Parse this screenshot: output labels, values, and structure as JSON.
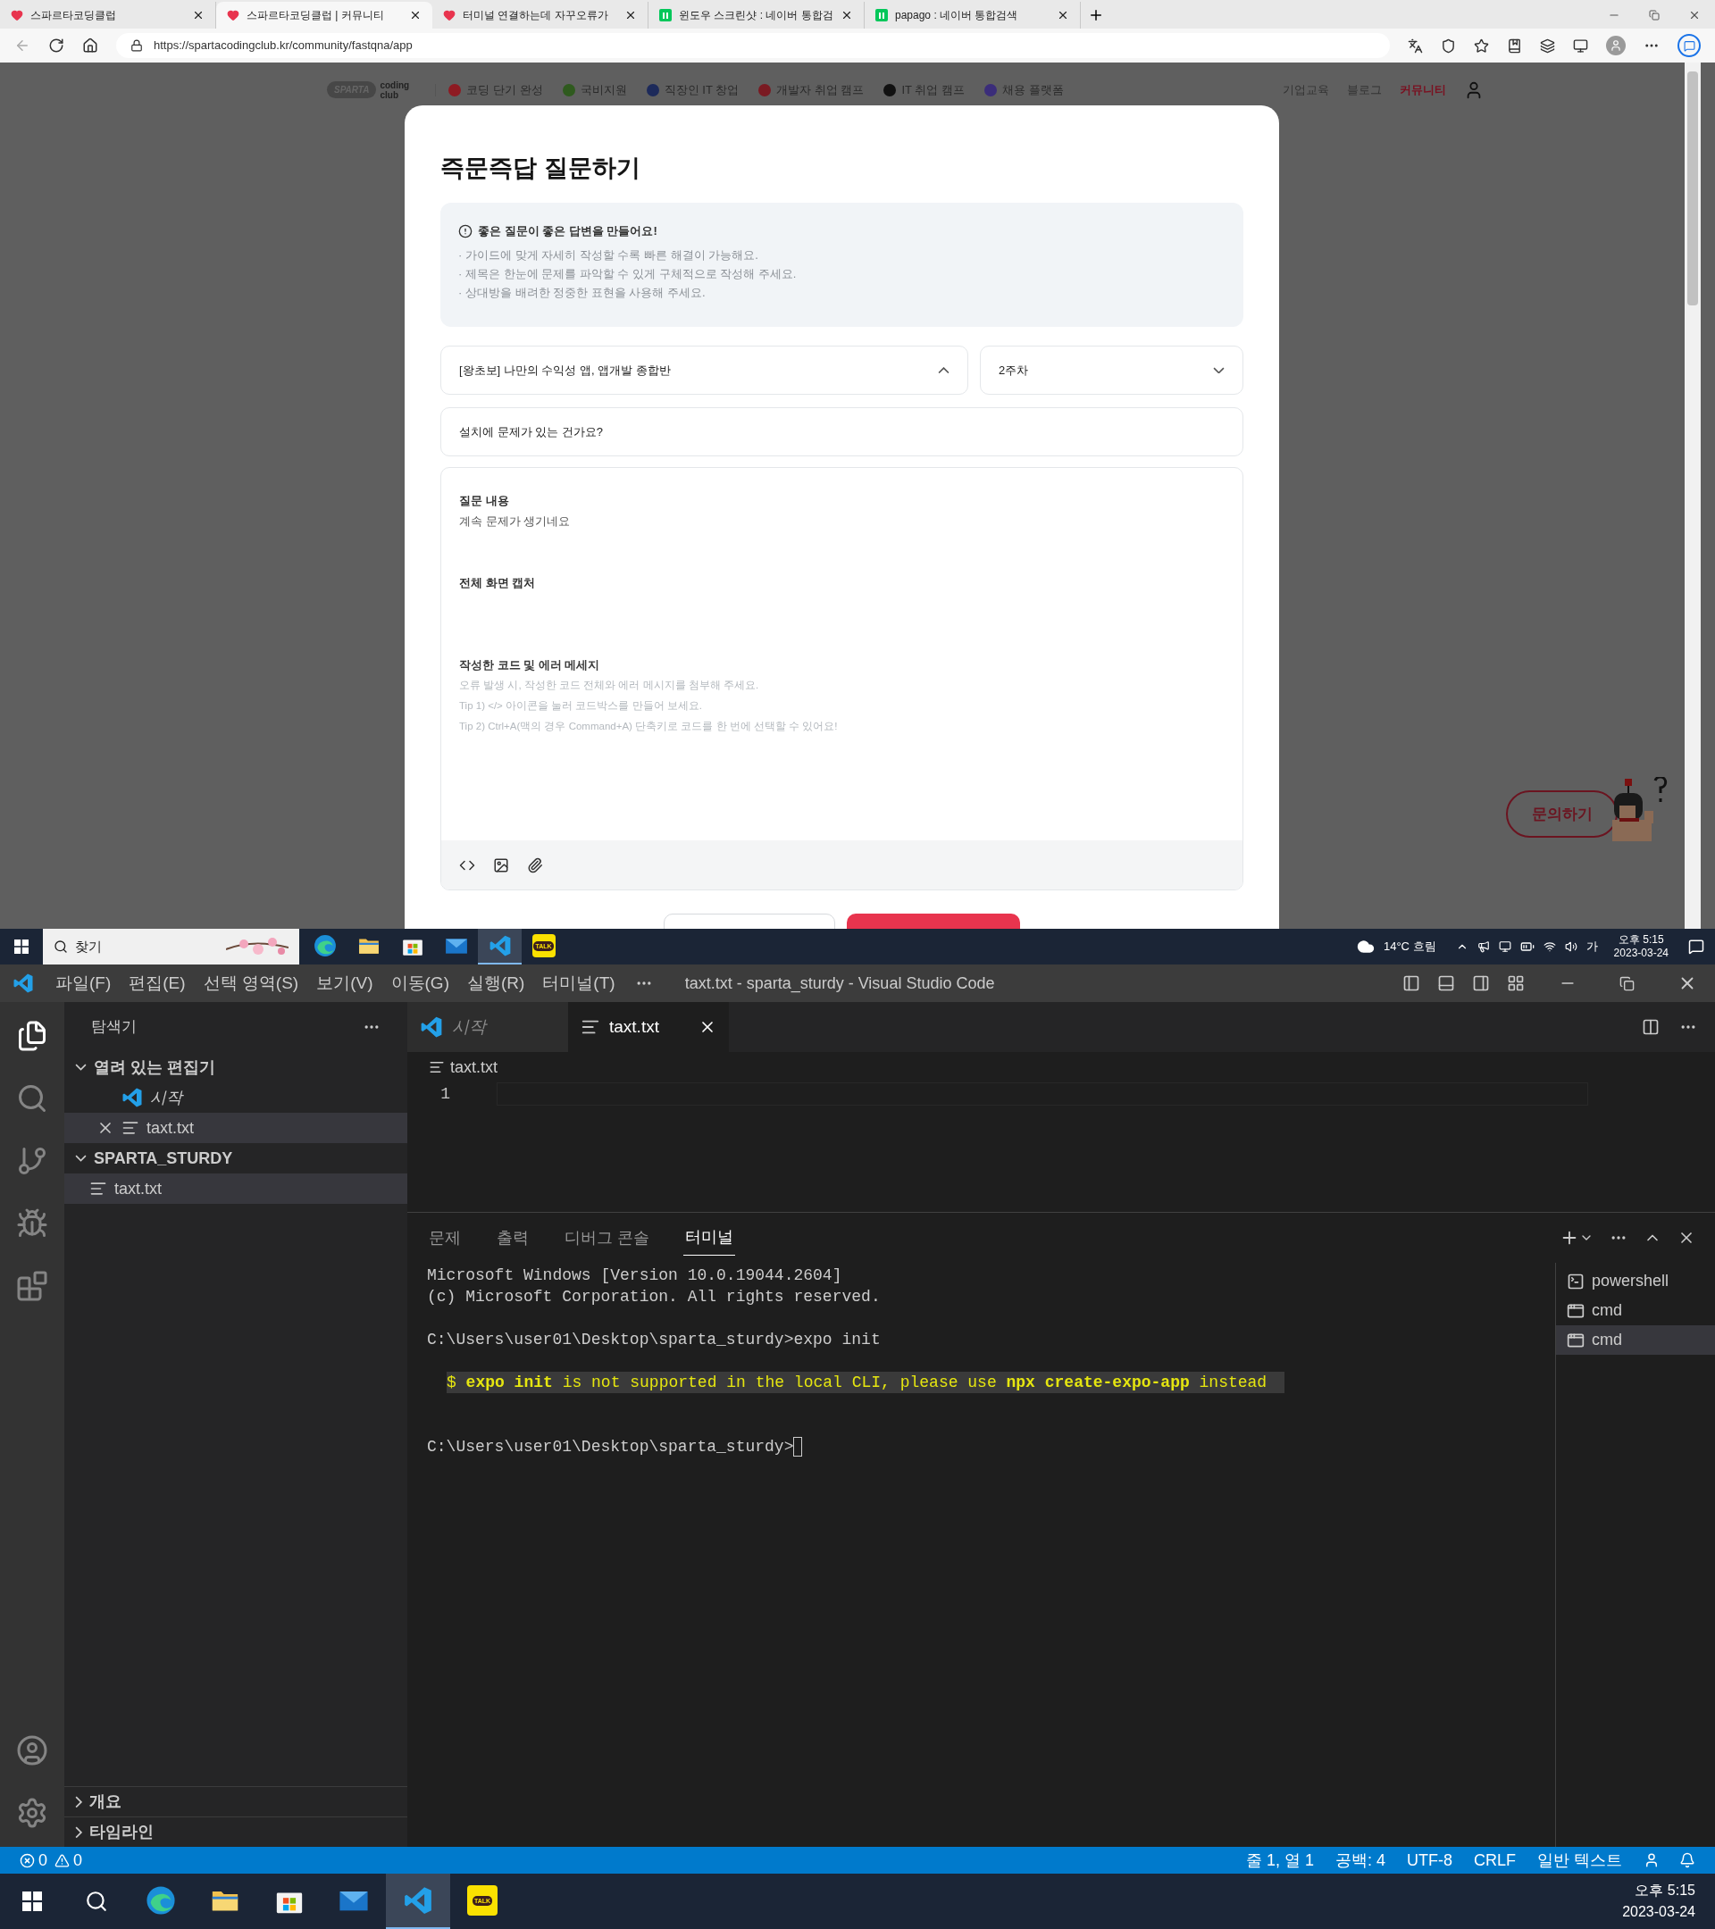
{
  "browser": {
    "tabs": [
      {
        "title": "스파르타코딩클럽",
        "selected": false,
        "kind": "sparta"
      },
      {
        "title": "스파르타코딩클럽 | 커뮤니티",
        "selected": true,
        "kind": "sparta"
      },
      {
        "title": "터미널 연결하는데 자꾸오류가",
        "selected": false,
        "kind": "sparta"
      },
      {
        "title": "윈도우 스크린샷 : 네이버 통합검",
        "selected": false,
        "kind": "naver"
      },
      {
        "title": "papago : 네이버 통합검색",
        "selected": false,
        "kind": "naver"
      }
    ],
    "url": "https://spartacodingclub.kr/community/fastqna/app"
  },
  "site": {
    "logo_words": [
      "SPARTA",
      "coding club"
    ],
    "nav": [
      {
        "label": "코딩 단기 완성",
        "color": "#8e1a22"
      },
      {
        "label": "국비지원",
        "color": "#2f5a1e"
      },
      {
        "label": "직장인 IT 창업",
        "color": "#1d2a5a"
      },
      {
        "label": "개발자 취업 캠프",
        "color": "#7a1a22"
      },
      {
        "label": "IT 취업 캠프",
        "color": "#111111"
      },
      {
        "label": "채용 플랫폼",
        "color": "#3b2d7a"
      }
    ],
    "links": [
      {
        "label": "기업교육",
        "selected": false
      },
      {
        "label": "블로그",
        "selected": false
      },
      {
        "label": "커뮤니티",
        "selected": true
      }
    ],
    "help_button": "문의하기"
  },
  "modal": {
    "title": "즉문즉답 질문하기",
    "notice": {
      "heading": "좋은 질문이 좋은 답변을 만들어요!",
      "lines": [
        "· 가이드에 맞게 자세히 작성할 수록 빠른 해결이 가능해요.",
        "· 제목은 한눈에 문제를 파악할 수 있게 구체적으로 작성해 주세요.",
        "· 상대방을 배려한 정중한 표현을 사용해 주세요."
      ]
    },
    "course_select": {
      "value": "[왕초보] 나만의 수익성 앱, 앱개발 종합반",
      "expanded": true
    },
    "week_select": {
      "value": "2주차",
      "expanded": false
    },
    "title_field": {
      "value": "설치에 문제가 있는 건가요?"
    },
    "sections": [
      {
        "heading": "질문 내용",
        "kind": "text",
        "lines": [
          "계속 문제가 생기네요"
        ]
      },
      {
        "heading": "전체 화면 캡처",
        "kind": "text"
      },
      {
        "heading": "작성한 코드 및 에러 메세지",
        "kind": "hint",
        "lines": [
          "오류 발생 시, 작성한 코드 전체와 에러 메시지를 첨부해 주세요.",
          "Tip 1) </> 아이콘을 눌러 코드박스를 만들어 보세요.",
          "Tip 2) Ctrl+A(맥의 경우 Command+A) 단축키로 코드를 한 번에 선택할 수 있어요!"
        ]
      }
    ]
  },
  "taskbar_top": {
    "search_placeholder": "찾기",
    "weather": "14°C 흐림",
    "ime": "가",
    "time": "오후 5:15",
    "date": "2023-03-24",
    "apps": [
      {
        "kind": "edge",
        "active": false
      },
      {
        "kind": "files",
        "active": false
      },
      {
        "kind": "store",
        "active": false
      },
      {
        "kind": "mail",
        "active": false
      },
      {
        "kind": "vscode",
        "active": true
      },
      {
        "kind": "kakao",
        "label": "TALK",
        "active": false
      }
    ]
  },
  "vscode": {
    "menu": [
      "파일(F)",
      "편집(E)",
      "선택 영역(S)",
      "보기(V)",
      "이동(G)",
      "실행(R)",
      "터미널(T)"
    ],
    "title": "taxt.txt - sparta_sturdy - Visual Studio Code",
    "explorer": {
      "title": "탐색기",
      "sections": [
        {
          "label": "열려 있는 편집기",
          "expanded": true,
          "kind": "open_editors",
          "items": [
            {
              "name": "시작",
              "kind": "welcome",
              "selected": false
            },
            {
              "name": "taxt.txt",
              "kind": "file",
              "selected": true
            }
          ]
        },
        {
          "label": "SPARTA_STURDY",
          "expanded": true,
          "kind": "folder",
          "items": [
            {
              "name": "taxt.txt",
              "kind": "file",
              "selected": true
            }
          ]
        }
      ],
      "bottom_sections": [
        {
          "label": "개요",
          "expanded": false
        },
        {
          "label": "타임라인",
          "expanded": false
        }
      ]
    },
    "editor_tabs": [
      {
        "label": "시작",
        "kind": "welcome",
        "selected": false
      },
      {
        "label": "taxt.txt",
        "kind": "file",
        "selected": true
      }
    ],
    "breadcrumb": "taxt.txt",
    "line_numbers": [
      "1"
    ],
    "panel_tabs": [
      {
        "label": "문제",
        "selected": false
      },
      {
        "label": "출력",
        "selected": false
      },
      {
        "label": "디버그 콘솔",
        "selected": false
      },
      {
        "label": "터미널",
        "selected": true
      }
    ],
    "terminal_lines": [
      {
        "kind": "text",
        "text": "Microsoft Windows [Version 10.0.19044.2604]"
      },
      {
        "kind": "text",
        "text": "(c) Microsoft Corporation. All rights reserved."
      },
      {
        "kind": "blank"
      },
      {
        "kind": "text",
        "text": "C:\\Users\\user01\\Desktop\\sparta_sturdy>expo init"
      },
      {
        "kind": "blank"
      },
      {
        "kind": "warning",
        "text": "$ **expo init** is not supported in the local CLI, please use **npx create-expo-app** instead"
      },
      {
        "kind": "blank"
      },
      {
        "kind": "blank"
      },
      {
        "kind": "prompt",
        "text": "C:\\Users\\user01\\Desktop\\sparta_sturdy>"
      }
    ],
    "terminals": [
      {
        "name": "powershell",
        "kind": "powershell",
        "selected": false
      },
      {
        "name": "cmd",
        "kind": "cmd",
        "selected": false
      },
      {
        "name": "cmd",
        "kind": "cmd",
        "selected": true
      }
    ],
    "status": {
      "errors": "0",
      "warnings": "0",
      "items": [
        "줄 1, 열 1",
        "공백: 4",
        "UTF-8",
        "CRLF",
        "일반 텍스트"
      ]
    }
  },
  "taskbar_bottom": {
    "time": "오후 5:15",
    "date": "2023-03-24",
    "apps": [
      {
        "kind": "edge",
        "active": false
      },
      {
        "kind": "files",
        "active": false
      },
      {
        "kind": "store",
        "active": false
      },
      {
        "kind": "mail",
        "active": false
      },
      {
        "kind": "vscode",
        "active": true
      },
      {
        "kind": "kakao",
        "label": "TALK",
        "active": false
      }
    ]
  }
}
